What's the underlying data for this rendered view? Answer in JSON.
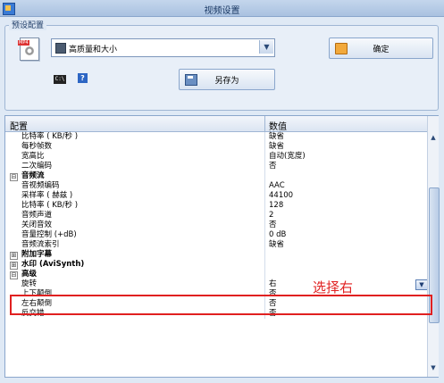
{
  "window": {
    "title": "视频设置"
  },
  "preset": {
    "group_label": "预设配置",
    "selected": "高质量和大小",
    "ok_label": "确定",
    "save_as_label": "另存为",
    "cmd_icon_text": "C:\\"
  },
  "grid": {
    "col_config": "配置",
    "col_value": "数值",
    "rows": [
      {
        "name": "比特率 ( KB/秒 )",
        "value": "缺省"
      },
      {
        "name": "每秒帧数",
        "value": "缺省"
      },
      {
        "name": "宽高比",
        "value": "自动(宽度)"
      },
      {
        "name": "二次编码",
        "value": "否"
      },
      {
        "name": "音频流",
        "value": "",
        "category": true,
        "toggle": "⊟"
      },
      {
        "name": "音视频编码",
        "value": "AAC"
      },
      {
        "name": "采样率 ( 赫兹 )",
        "value": "44100"
      },
      {
        "name": "比特率 ( KB/秒 )",
        "value": "128"
      },
      {
        "name": "音频声道",
        "value": "2"
      },
      {
        "name": "关闭音效",
        "value": "否"
      },
      {
        "name": "音量控制 (+dB)",
        "value": "0 dB"
      },
      {
        "name": "音频流索引",
        "value": "缺省"
      },
      {
        "name": "附加字幕",
        "value": "",
        "category": true,
        "toggle": "⊞"
      },
      {
        "name": "水印 (AviSynth)",
        "value": "",
        "category": true,
        "toggle": "⊞"
      },
      {
        "name": "高级",
        "value": "",
        "category": true,
        "toggle": "⊟"
      },
      {
        "name": "旋转",
        "value": "右",
        "selected": true
      },
      {
        "name": "上下颠倒",
        "value": "否"
      },
      {
        "name": "左右颠倒",
        "value": "否"
      },
      {
        "name": "反交错",
        "value": "否"
      }
    ]
  },
  "annotation": {
    "text": "选择右"
  },
  "colors": {
    "highlight": "#e02020",
    "accent": "#8aa6cc"
  }
}
